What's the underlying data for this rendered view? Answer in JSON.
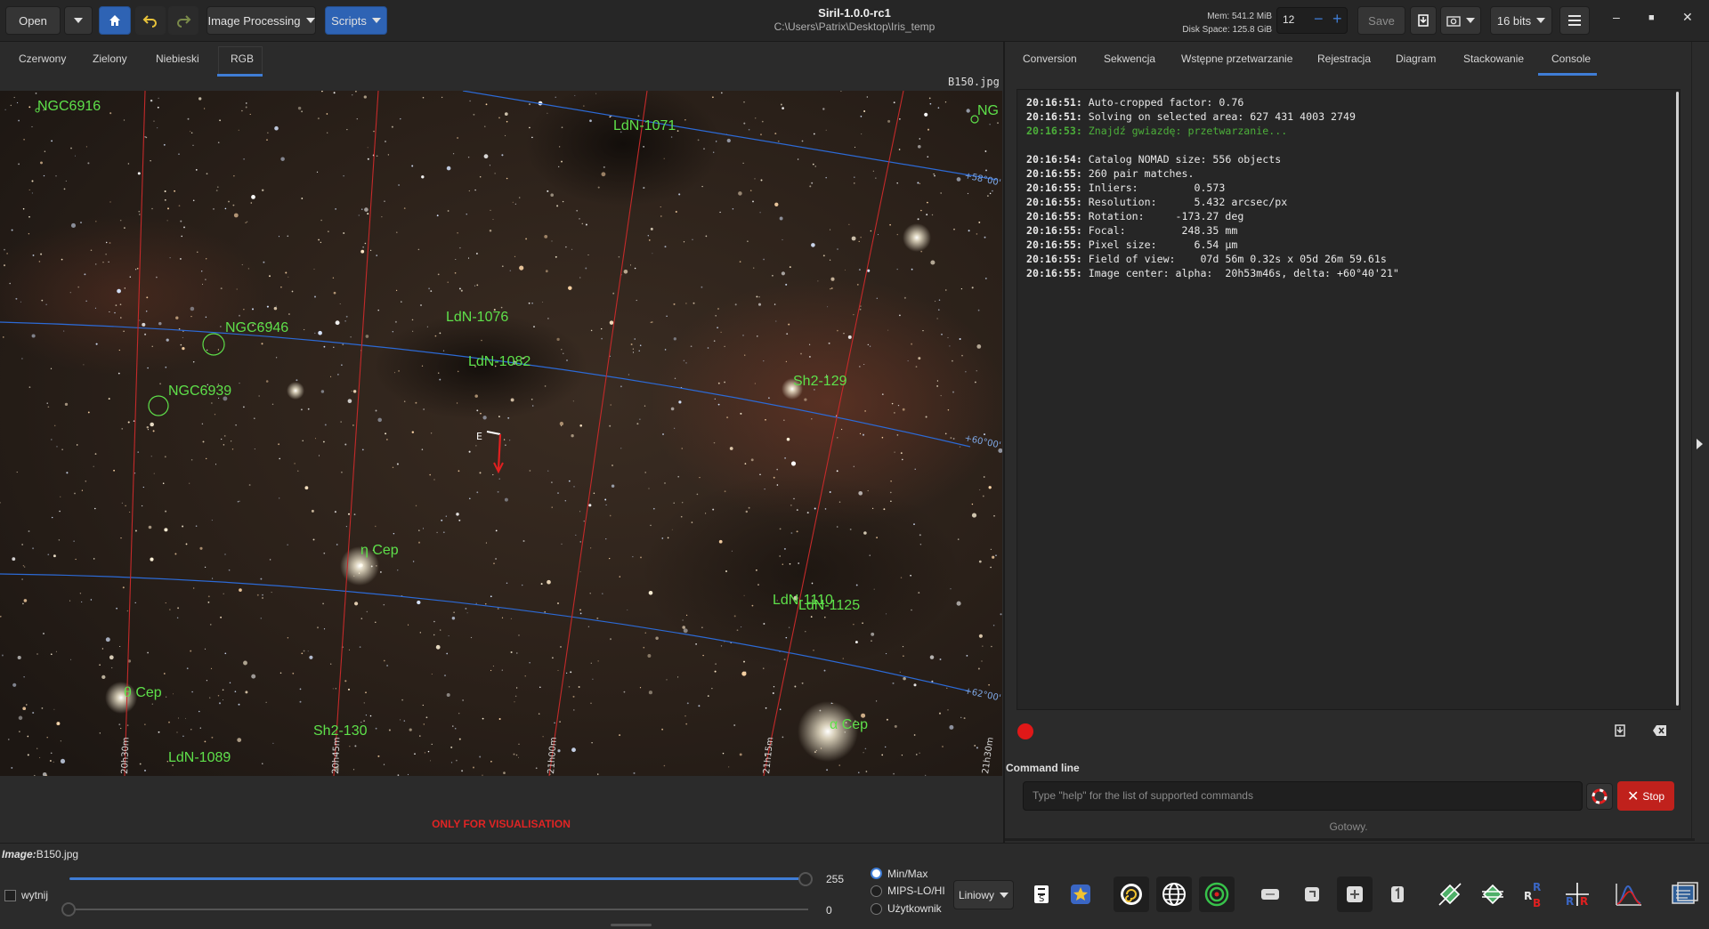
{
  "app": {
    "title": "Siril-1.0.0-rc1",
    "path": "C:\\Users\\Patrix\\Desktop\\Iris_temp"
  },
  "toolbar": {
    "open_label": "Open",
    "image_processing_label": "Image Processing",
    "scripts_label": "Scripts",
    "mem": "Mem: 541.2 MiB",
    "disk": "Disk Space: 125.8 GiB",
    "spin_value": "12",
    "save_label": "Save",
    "bits_label": "16 bits"
  },
  "left_tabs": [
    "Czerwony",
    "Zielony",
    "Niebieski",
    "RGB"
  ],
  "image": {
    "filename": "B150.jpg",
    "visualisation_note": "ONLY FOR VISUALISATION",
    "objects": [
      "NGC6916",
      "NG",
      "LdN-1071",
      "NGC6946",
      "LdN-1076",
      "LdN-1082",
      "NGC6939",
      "Sh2-129",
      "η Cep",
      "LdN-1110",
      "LdN-1125",
      "θ Cep",
      "α Cep",
      "Sh2-130",
      "LdN-1089"
    ],
    "dec_labels": [
      "+58°00'",
      "+60°00'",
      "+62°00'"
    ],
    "ra_labels": [
      "20h30m",
      "20h45m",
      "21h00m",
      "21h15m",
      "21h30m"
    ],
    "compass_label": "E"
  },
  "right_tabs": [
    "Conversion",
    "Sekwencja",
    "Wstępne przetwarzanie",
    "Rejestracja",
    "Diagram",
    "Stackowanie",
    "Console"
  ],
  "console": [
    {
      "t": "20:16:51:",
      "m": " Auto-cropped factor: 0.76",
      "green": false
    },
    {
      "t": "20:16:51:",
      "m": " Solving on selected area: 627 431 4003 2749",
      "green": false
    },
    {
      "t": "20:16:53:",
      "m": " Znajdź gwiazdę: przetwarzanie...",
      "green": true
    },
    {
      "t": "",
      "m": "",
      "green": false
    },
    {
      "t": "20:16:54:",
      "m": " Catalog NOMAD size: 556 objects",
      "green": false
    },
    {
      "t": "20:16:55:",
      "m": " 260 pair matches.",
      "green": false
    },
    {
      "t": "20:16:55:",
      "m": " Inliers:         0.573",
      "green": false
    },
    {
      "t": "20:16:55:",
      "m": " Resolution:      5.432 arcsec/px",
      "green": false
    },
    {
      "t": "20:16:55:",
      "m": " Rotation:     -173.27 deg",
      "green": false
    },
    {
      "t": "20:16:55:",
      "m": " Focal:         248.35 mm",
      "green": false
    },
    {
      "t": "20:16:55:",
      "m": " Pixel size:      6.54 µm",
      "green": false
    },
    {
      "t": "20:16:55:",
      "m": " Field of view:    07d 56m 0.32s x 05d 26m 59.61s",
      "green": false
    },
    {
      "t": "20:16:55:",
      "m": " Image center: alpha:  20h53m46s, delta: +60°40'21\"",
      "green": false
    }
  ],
  "command": {
    "label": "Command line",
    "placeholder": "Type \"help\" for the list of supported commands",
    "stop_label": "Stop",
    "status": "Gotowy."
  },
  "bottom": {
    "image_label": "Image:",
    "image_name": "B150.jpg",
    "crop_label": "wytnij",
    "slider_high": "255",
    "slider_low": "0",
    "radios": [
      "Min/Max",
      "MIPS-LO/HI",
      "Użytkownik"
    ],
    "radio_selected": "Min/Max",
    "mode_label": "Liniowy"
  },
  "colors": {
    "accent": "#3f7dd6",
    "stop": "#c0211c",
    "label_green": "#5ee04a"
  }
}
